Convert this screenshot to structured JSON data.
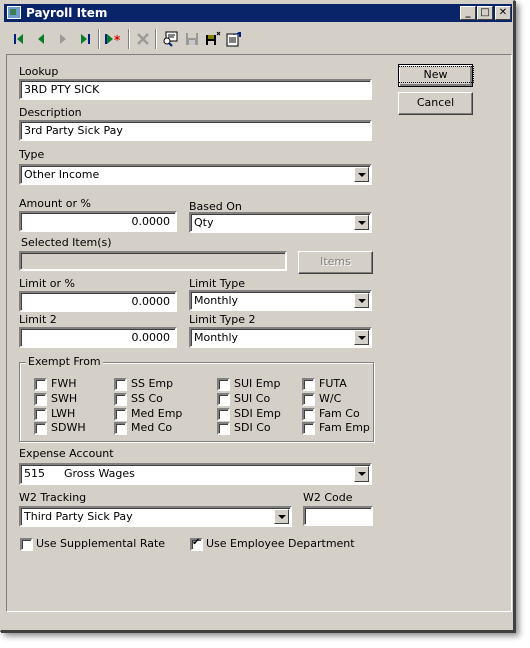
{
  "window": {
    "title": "Payroll Item"
  },
  "titlebar_buttons": {
    "minimize": "_",
    "maximize": "□",
    "close": "✕"
  },
  "toolbar": {
    "items": [
      {
        "name": "first-record",
        "icon": "first-icon"
      },
      {
        "name": "previous-record",
        "icon": "previous-icon"
      },
      {
        "name": "next-record",
        "icon": "next-icon"
      },
      {
        "name": "last-record",
        "icon": "last-icon"
      },
      {
        "name": "new-record",
        "icon": "new-record-icon"
      },
      {
        "name": "delete-record",
        "icon": "delete-icon"
      },
      {
        "name": "find",
        "icon": "find-icon"
      },
      {
        "name": "save",
        "icon": "save-icon"
      },
      {
        "name": "save-close",
        "icon": "save-close-icon"
      },
      {
        "name": "properties",
        "icon": "properties-icon"
      }
    ]
  },
  "buttons": {
    "new": "New",
    "cancel": "Cancel",
    "items": "Items"
  },
  "form": {
    "lookup": {
      "label": "Lookup",
      "value": "3RD PTY SICK"
    },
    "description": {
      "label": "Description",
      "value": "3rd Party Sick Pay"
    },
    "type": {
      "label": "Type",
      "value": "Other Income"
    },
    "amount": {
      "label": "Amount or %",
      "value": "0.0000"
    },
    "based_on": {
      "label": "Based On",
      "value": "Qty"
    },
    "selected_items": {
      "label": "Selected Item(s)",
      "value": ""
    },
    "limit": {
      "label": "Limit or %",
      "value": "0.0000"
    },
    "limit_type": {
      "label": "Limit Type",
      "value": "Monthly"
    },
    "limit2": {
      "label": "Limit 2",
      "value": "0.0000"
    },
    "limit_type2": {
      "label": "Limit Type 2",
      "value": "Monthly"
    },
    "exempt_from": {
      "label": "Exempt From",
      "columns": [
        [
          {
            "label": "FWH",
            "checked": false
          },
          {
            "label": "SWH",
            "checked": false
          },
          {
            "label": "LWH",
            "checked": false
          },
          {
            "label": "SDWH",
            "checked": false
          }
        ],
        [
          {
            "label": "SS Emp",
            "checked": false
          },
          {
            "label": "SS Co",
            "checked": false
          },
          {
            "label": "Med Emp",
            "checked": false
          },
          {
            "label": "Med Co",
            "checked": false
          }
        ],
        [
          {
            "label": "SUI Emp",
            "checked": false
          },
          {
            "label": "SUI Co",
            "checked": false
          },
          {
            "label": "SDI Emp",
            "checked": false
          },
          {
            "label": "SDI Co",
            "checked": false
          }
        ],
        [
          {
            "label": "FUTA",
            "checked": false
          },
          {
            "label": "W/C",
            "checked": false
          },
          {
            "label": "Fam Co",
            "checked": false
          },
          {
            "label": "Fam Emp",
            "checked": false
          }
        ]
      ]
    },
    "expense_account": {
      "label": "Expense Account",
      "code": "515",
      "name": "Gross Wages"
    },
    "w2_tracking": {
      "label": "W2 Tracking",
      "value": "Third Party Sick Pay"
    },
    "w2_code": {
      "label": "W2 Code",
      "value": ""
    },
    "use_supplemental_rate": {
      "label": "Use Supplemental Rate",
      "checked": false
    },
    "use_employee_department": {
      "label": "Use Employee Department",
      "checked": true
    }
  }
}
